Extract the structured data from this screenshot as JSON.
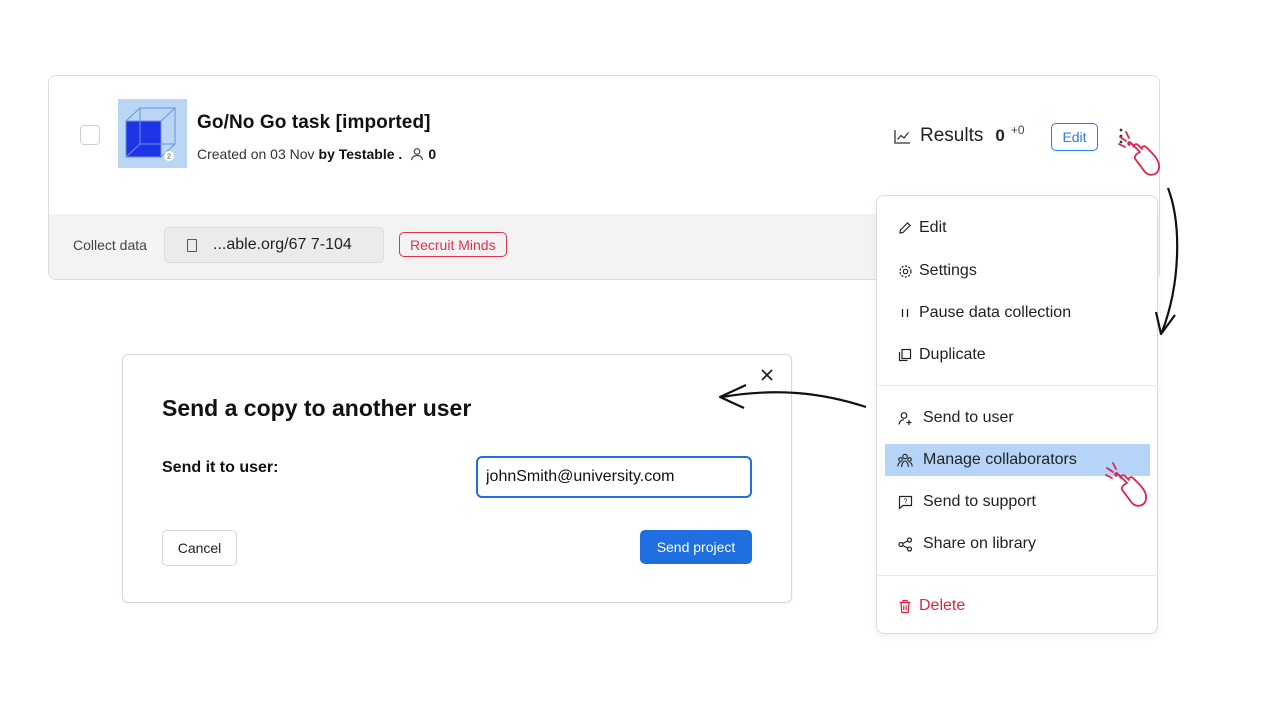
{
  "project": {
    "title": "Go/No Go task [imported]",
    "created_prefix": "Created on 03 Nov",
    "created_by": "by Testable .",
    "participants": "0",
    "thumb_badge": "2"
  },
  "results": {
    "label": "Results",
    "count": "0",
    "delta": "+0",
    "edit_label": "Edit"
  },
  "collect": {
    "label": "Collect data",
    "url": "...able.org/67 7-104",
    "recruit_label": "Recruit Minds"
  },
  "menu": {
    "items": [
      {
        "label": "Edit",
        "icon": "pencil-icon"
      },
      {
        "label": "Settings",
        "icon": "gear-icon"
      },
      {
        "label": "Pause data collection",
        "icon": "pause-icon"
      },
      {
        "label": "Duplicate",
        "icon": "duplicate-icon"
      },
      {
        "label": "Send to user",
        "icon": "user-plus-icon"
      },
      {
        "label": "Manage collaborators",
        "icon": "collaborators-icon"
      },
      {
        "label": "Send to support",
        "icon": "support-icon"
      },
      {
        "label": "Share on library",
        "icon": "share-icon"
      },
      {
        "label": "Delete",
        "icon": "trash-icon"
      }
    ],
    "active_item": "Manage collaborators"
  },
  "modal": {
    "title": "Send a copy to another user",
    "field_label": "Send it to user:",
    "field_value": "johnSmith@university.com",
    "cancel_label": "Cancel",
    "submit_label": "Send project"
  },
  "colors": {
    "accent": "#1f6fe0",
    "danger": "#e0253f",
    "highlight": "#b6d4f8",
    "annotation": "#e0234d"
  }
}
